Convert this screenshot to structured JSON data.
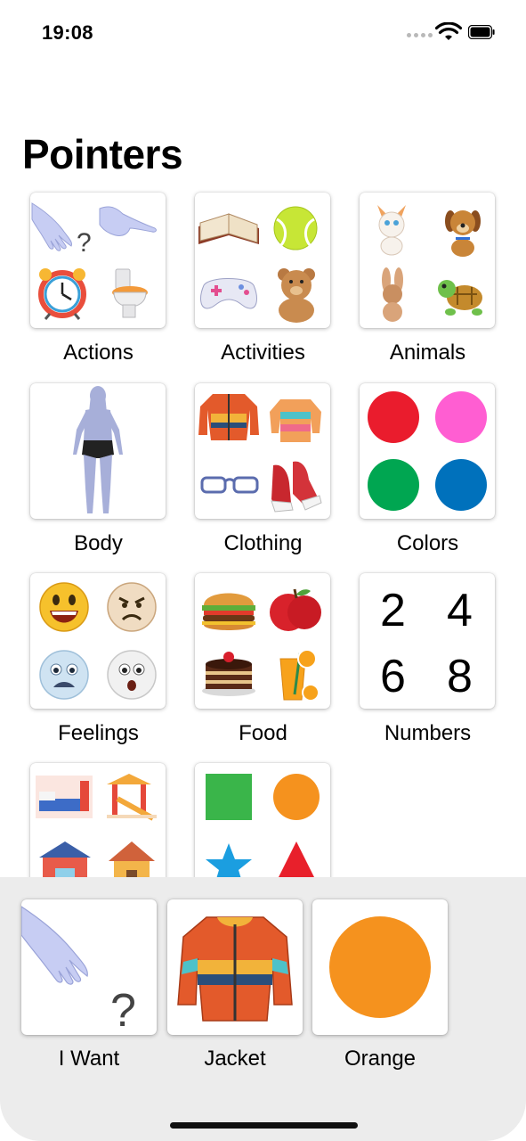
{
  "status_bar": {
    "time": "19:08"
  },
  "title": "Pointers",
  "categories": [
    {
      "label": "Actions"
    },
    {
      "label": "Activities"
    },
    {
      "label": "Animals"
    },
    {
      "label": "Body"
    },
    {
      "label": "Clothing"
    },
    {
      "label": "Colors"
    },
    {
      "label": "Feelings"
    },
    {
      "label": "Food"
    },
    {
      "label": "Numbers",
      "digits": [
        "2",
        "4",
        "6",
        "8"
      ]
    },
    {
      "label": ""
    },
    {
      "label": ""
    }
  ],
  "sentence": [
    {
      "label": "I Want"
    },
    {
      "label": "Jacket"
    },
    {
      "label": "Orange",
      "color": "#f5921e"
    }
  ],
  "colors": {
    "red": "#ea1c2d",
    "pink": "#ff5ed2",
    "green": "#00a651",
    "blue": "#0071bc",
    "orange": "#f5921e",
    "shape_green": "#3ab54a",
    "star_blue": "#1b9ee0",
    "triangle_red": "#e8202b"
  }
}
